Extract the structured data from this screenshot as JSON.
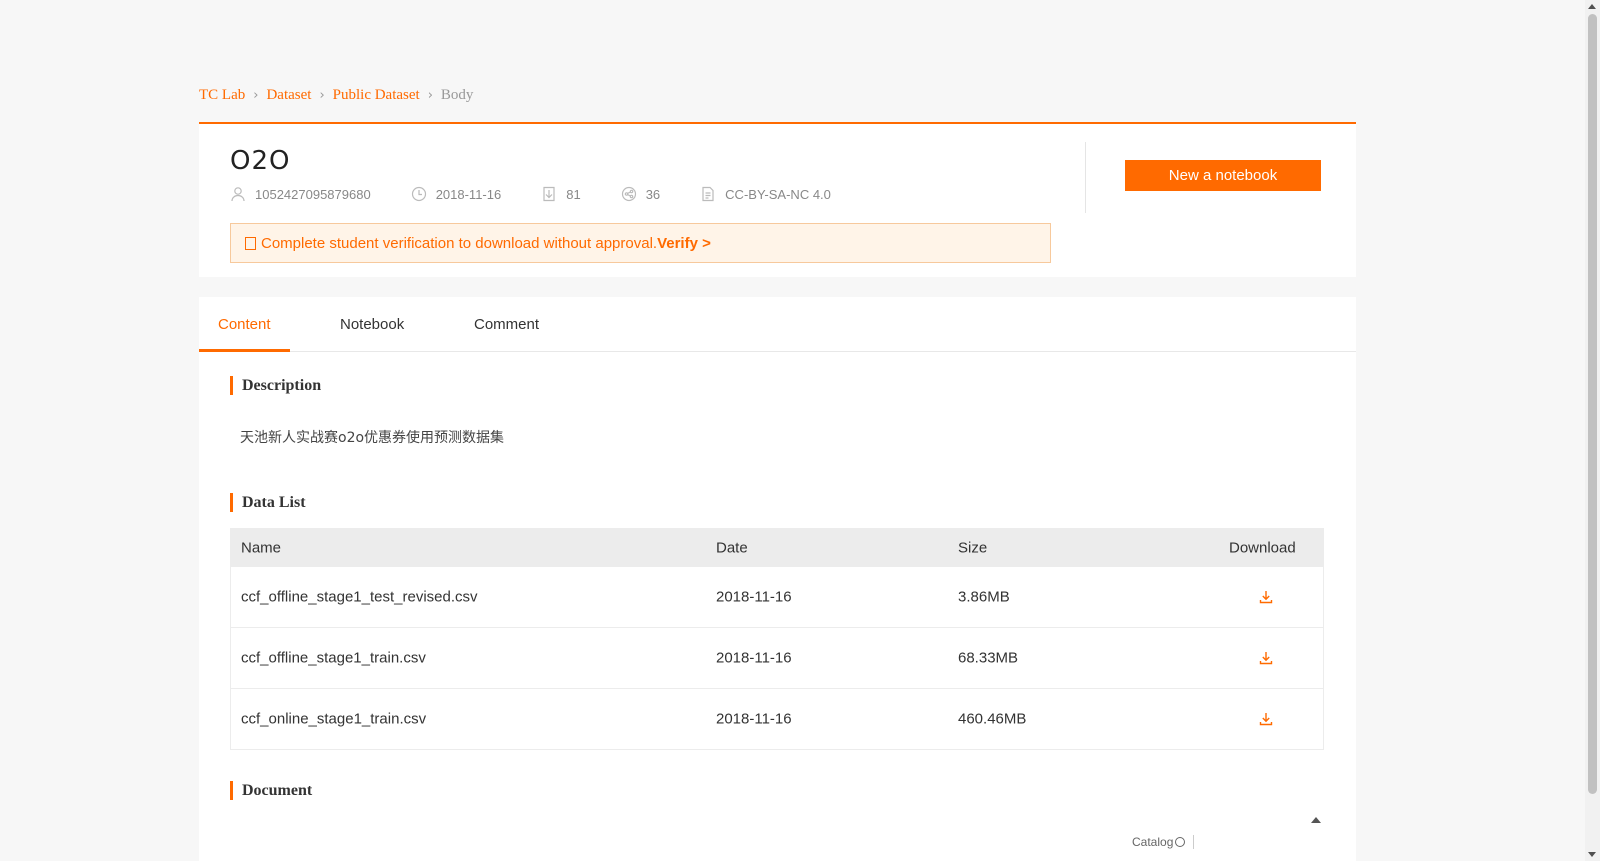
{
  "breadcrumb": {
    "items": [
      "TC Lab",
      "Dataset",
      "Public Dataset"
    ],
    "current": "Body",
    "separator": ">"
  },
  "dataset": {
    "title": "O2O",
    "meta": {
      "user": "1052427095879680",
      "date": "2018-11-16",
      "downloads": "81",
      "shares": "36",
      "license": "CC-BY-SA-NC 4.0"
    }
  },
  "notice": {
    "text": "Complete student verification to download without approval.",
    "link": "Verify >"
  },
  "actions": {
    "new_notebook": "New a notebook"
  },
  "tabs": [
    {
      "label": "Content",
      "active": true
    },
    {
      "label": "Notebook",
      "active": false
    },
    {
      "label": "Comment",
      "active": false
    }
  ],
  "description": {
    "heading": "Description",
    "text": "天池新人实战赛o2o优惠券使用预测数据集"
  },
  "data_list": {
    "heading": "Data List",
    "columns": [
      "Name",
      "Date",
      "Size",
      "Download"
    ],
    "rows": [
      {
        "name": "ccf_offline_stage1_test_revised.csv",
        "date": "2018-11-16",
        "size": "3.86MB"
      },
      {
        "name": "ccf_offline_stage1_train.csv",
        "date": "2018-11-16",
        "size": "68.33MB"
      },
      {
        "name": "ccf_online_stage1_train.csv",
        "date": "2018-11-16",
        "size": "460.46MB"
      }
    ]
  },
  "document": {
    "heading": "Document",
    "catalog_label": "Catalog"
  },
  "icons": {
    "user": "user-icon",
    "clock": "clock-icon",
    "download": "download-icon",
    "share": "share-icon",
    "license": "document-icon"
  },
  "colors": {
    "accent": "#ff6a00",
    "notice_bg": "#fff4e8",
    "page_bg": "#f7f7f7"
  }
}
